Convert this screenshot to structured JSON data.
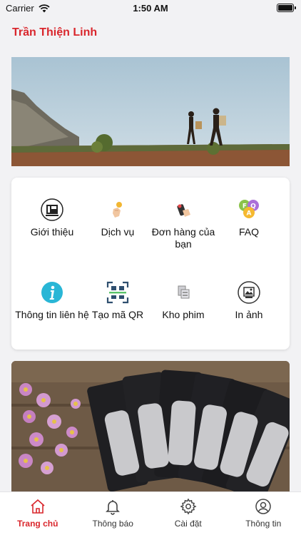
{
  "status_bar": {
    "carrier": "Carrier",
    "time": "1:50 AM"
  },
  "header": {
    "user_name": "Trần Thiện Linh",
    "accent_color": "#d9262c"
  },
  "menu": {
    "items": [
      {
        "label": "Giới thiệu",
        "icon": "logo-icon"
      },
      {
        "label": "Dịch vụ",
        "icon": "hand-coin-icon"
      },
      {
        "label": "Đơn hàng của bạn",
        "icon": "phone-cart-icon"
      },
      {
        "label": "FAQ",
        "icon": "faq-icon"
      },
      {
        "label": "Thông tin liên hệ",
        "icon": "info-icon"
      },
      {
        "label": "Tạo mã QR",
        "icon": "qr-scan-icon"
      },
      {
        "label": "Kho phim",
        "icon": "film-storage-icon"
      },
      {
        "label": "In ảnh",
        "icon": "photo-print-icon"
      }
    ]
  },
  "tabs": [
    {
      "label": "Trang chủ",
      "icon": "home-icon",
      "active": true
    },
    {
      "label": "Thông báo",
      "icon": "bell-icon",
      "active": false
    },
    {
      "label": "Cài đặt",
      "icon": "gear-icon",
      "active": false
    },
    {
      "label": "Thông tin",
      "icon": "user-icon",
      "active": false
    }
  ]
}
